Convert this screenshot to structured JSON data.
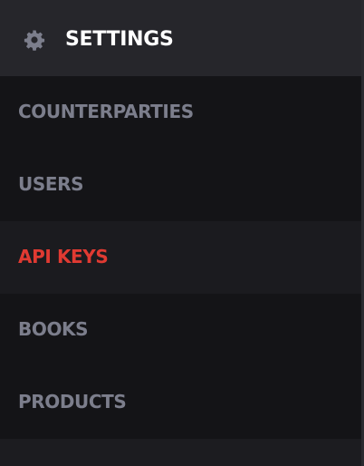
{
  "header": {
    "icon": "gear-icon",
    "title": "SETTINGS"
  },
  "menu": {
    "items": [
      {
        "label": "COUNTERPARTIES",
        "active": false
      },
      {
        "label": "USERS",
        "active": false
      },
      {
        "label": "API KEYS",
        "active": true
      },
      {
        "label": "BOOKS",
        "active": false
      },
      {
        "label": "PRODUCTS",
        "active": false
      }
    ]
  },
  "colors": {
    "active": "#e03a32",
    "inactive": "#7c7e8c",
    "header_bg": "#26262b",
    "item_bg": "#141417"
  }
}
